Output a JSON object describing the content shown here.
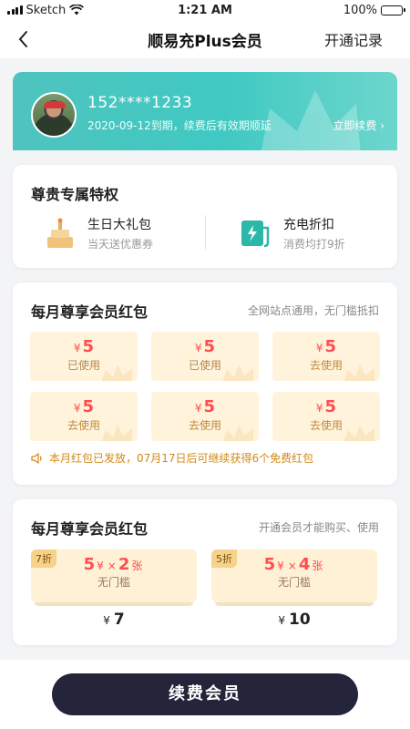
{
  "status_bar": {
    "carrier": "Sketch",
    "time": "1:21 AM",
    "battery": "100%",
    "battery_level": 1.0
  },
  "nav": {
    "title": "顺易充Plus会员",
    "right_link": "开通记录"
  },
  "member": {
    "phone": "152****1233",
    "expiry_text": "2020-09-12到期，续费后有效期顺延",
    "renew_link": "立即续费"
  },
  "privileges": {
    "title": "尊贵专属特权",
    "items": [
      {
        "title": "生日大礼包",
        "subtitle": "当天送优惠券",
        "icon": "cake-icon"
      },
      {
        "title": "充电折扣",
        "subtitle": "消费均打9折",
        "icon": "charger-icon"
      }
    ]
  },
  "monthly_coupons": {
    "title": "每月尊享会员红包",
    "subtitle": "全网站点通用，无门槛抵扣",
    "currency": "¥",
    "coupons": [
      {
        "amount": "5",
        "status": "已使用"
      },
      {
        "amount": "5",
        "status": "已使用"
      },
      {
        "amount": "5",
        "status": "去使用"
      },
      {
        "amount": "5",
        "status": "去使用"
      },
      {
        "amount": "5",
        "status": "去使用"
      },
      {
        "amount": "5",
        "status": "去使用"
      }
    ],
    "notice": "本月红包已发放，07月17日后可继续获得6个免费红包"
  },
  "packages": {
    "title": "每月尊享会员红包",
    "subtitle": "开通会员才能购买、使用",
    "items": [
      {
        "badge": "7折",
        "amount": "5",
        "currency": "¥",
        "times": "×",
        "count": "2",
        "unit": "张",
        "condition": "无门槛",
        "price": "7"
      },
      {
        "badge": "5折",
        "amount": "5",
        "currency": "¥",
        "times": "×",
        "count": "4",
        "unit": "张",
        "condition": "无门槛",
        "price": "10"
      }
    ]
  },
  "footer": {
    "renew_button": "续费会员"
  },
  "colors": {
    "accent_teal": "#40c9c2",
    "coupon_red": "#ff4d4f",
    "button_dark": "#24243a"
  }
}
